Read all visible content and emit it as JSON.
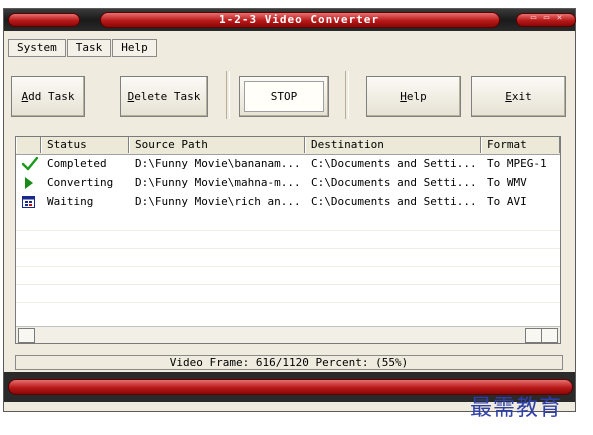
{
  "window": {
    "title": "1-2-3 Video Converter",
    "controls": [
      "▭",
      "▭",
      "✕"
    ]
  },
  "menu": [
    "System",
    "Task",
    "Help"
  ],
  "toolbar": {
    "add": {
      "hot": "A",
      "rest": "dd Task"
    },
    "delete": {
      "hot": "D",
      "rest": "elete Task"
    },
    "stop": "STOP",
    "help": {
      "hot": "H",
      "rest": "elp"
    },
    "exit": {
      "hot": "E",
      "rest": "xit"
    }
  },
  "columns": [
    "Status",
    "Source Path",
    "Destination",
    "Format"
  ],
  "rows": [
    {
      "icon": "check-icon",
      "status": "Completed",
      "source": "D:\\Funny Movie\\bananam...",
      "dest": "C:\\Documents and Setti...",
      "format": "To MPEG-1"
    },
    {
      "icon": "play-icon",
      "status": "Converting",
      "source": "D:\\Funny Movie\\mahna-m...",
      "dest": "C:\\Documents and Setti...",
      "format": "To WMV"
    },
    {
      "icon": "calendar-icon",
      "status": "Waiting",
      "source": "D:\\Funny Movie\\rich an...",
      "dest": "C:\\Documents and Setti...",
      "format": "To AVI"
    }
  ],
  "status": "Video Frame: 616/1120   Percent: (55%)",
  "watermark": "最需教育",
  "colors": {
    "accent_red": "#b81818",
    "check_green": "#1a9a1a",
    "play_green": "#1a8a1a",
    "watermark_blue": "#2d3fa8"
  }
}
